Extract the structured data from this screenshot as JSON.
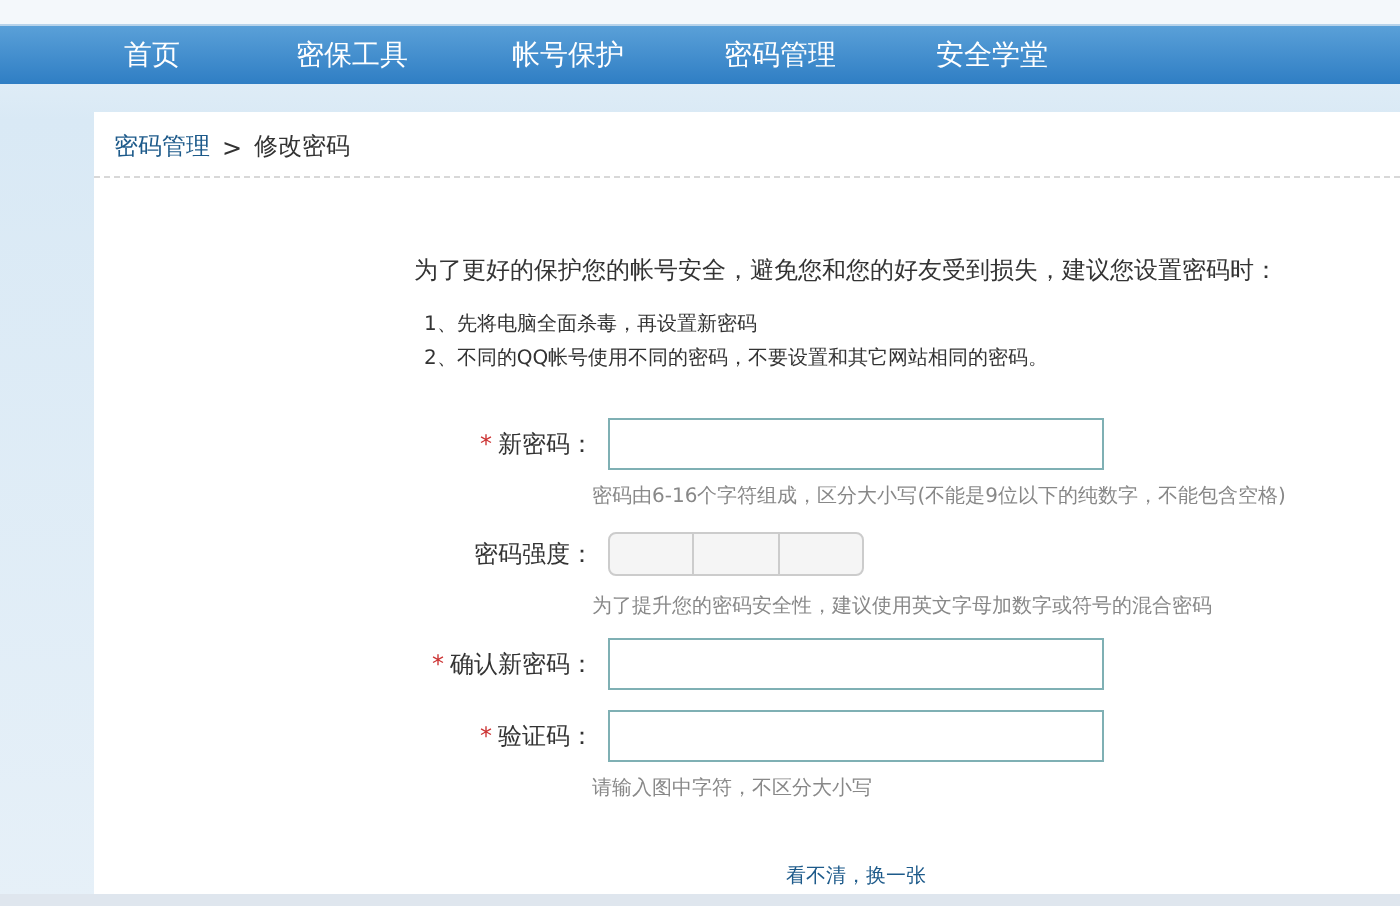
{
  "nav": [
    {
      "label": "首页"
    },
    {
      "label": "密保工具"
    },
    {
      "label": "帐号保护"
    },
    {
      "label": "密码管理"
    },
    {
      "label": "安全学堂"
    }
  ],
  "breadcrumb": {
    "parent": "密码管理",
    "separator": ">",
    "current": "修改密码"
  },
  "intro": "为了更好的保护您的帐号安全，避免您和您的好友受到损失，建议您设置密码时：",
  "tips": [
    "1、先将电脑全面杀毒，再设置新密码",
    "2、不同的QQ帐号使用不同的密码，不要设置和其它网站相同的密码。"
  ],
  "fields": [
    {
      "kind": "input",
      "asterisk": "*",
      "label": "新密码：",
      "hint": "密码由6-16个字符组成，区分大小写(不能是9位以下的纯数字，不能包含空格)"
    },
    {
      "kind": "meter",
      "label": "密码强度：",
      "hint": "为了提升您的密码安全性，建议使用英文字母加数字或符号的混合密码"
    },
    {
      "kind": "input",
      "asterisk": "*",
      "label": "确认新密码："
    },
    {
      "kind": "input",
      "asterisk": "*",
      "label": "验证码：",
      "hint": "请输入图中字符，不区分大小写"
    }
  ],
  "captcha_link": "看不清，换一张"
}
